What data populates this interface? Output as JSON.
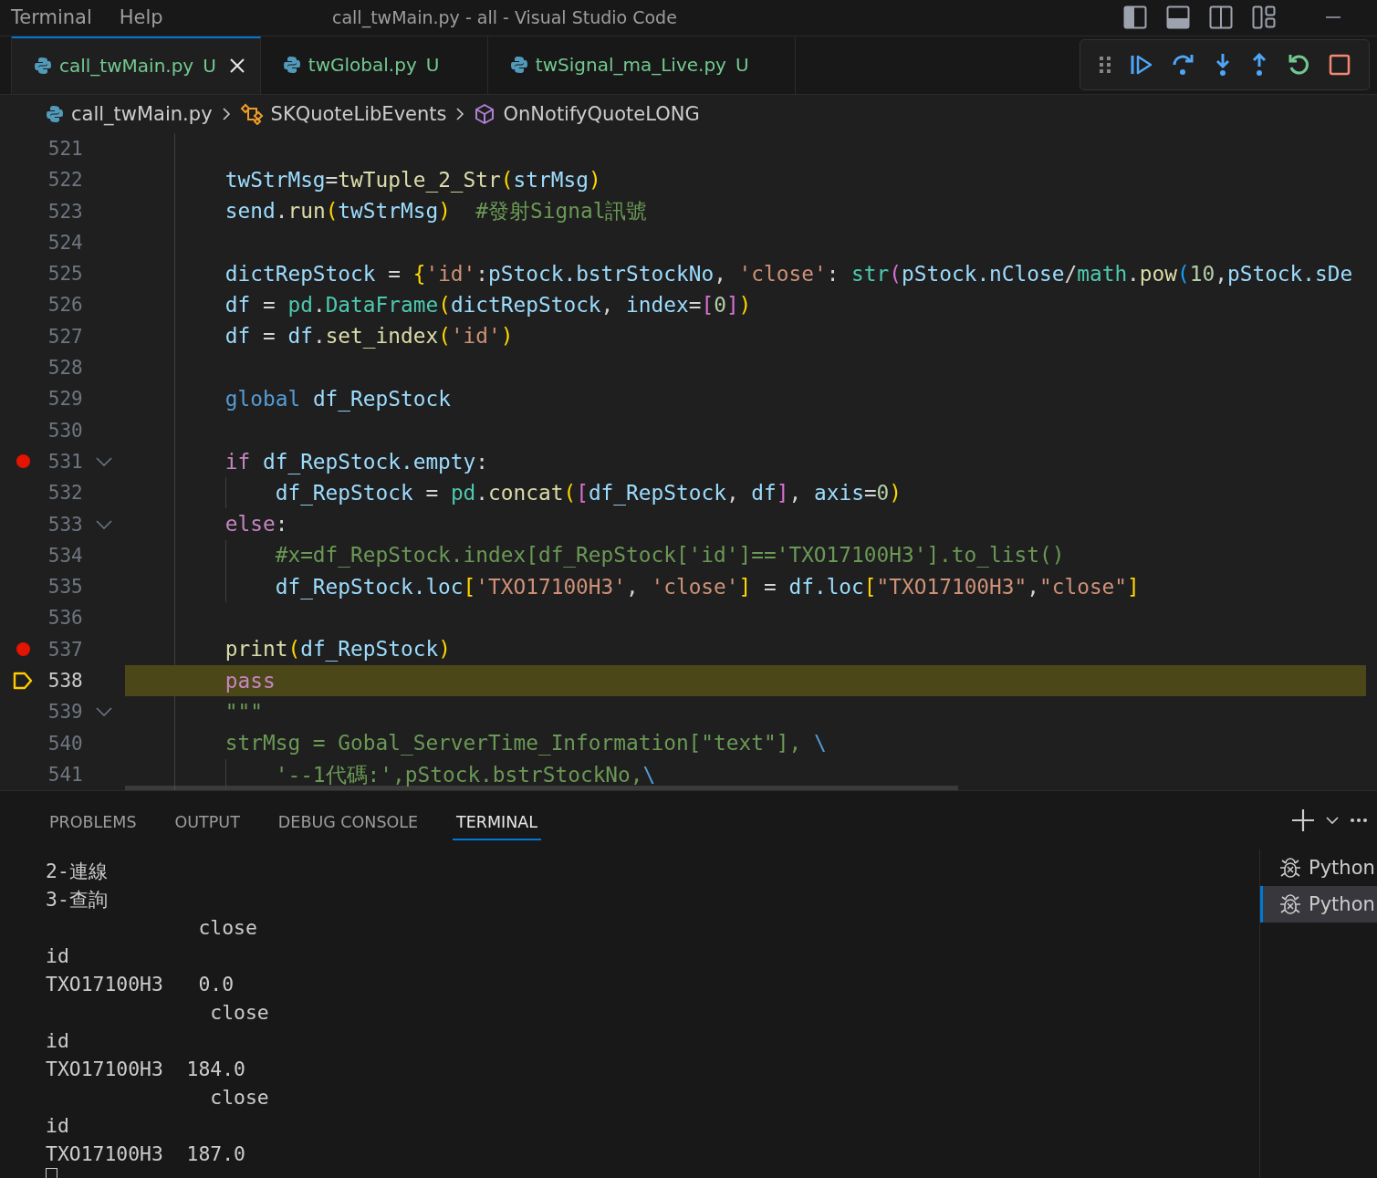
{
  "menu": [
    "Terminal",
    "Help"
  ],
  "window": {
    "title": "call_twMain.py - all - Visual Studio Code"
  },
  "tabs": [
    {
      "label": "call_twMain.py",
      "status": "U",
      "selected": true
    },
    {
      "label": "twGlobal.py",
      "status": "U",
      "selected": false
    },
    {
      "label": "twSignal_ma_Live.py",
      "status": "U",
      "selected": false
    }
  ],
  "breadcrumb": [
    {
      "label": "call_twMain.py",
      "kind": "file"
    },
    {
      "label": "SKQuoteLibEvents",
      "kind": "class"
    },
    {
      "label": "OnNotifyQuoteLONG",
      "kind": "method"
    }
  ],
  "editor": {
    "lines": [
      {
        "number": "521",
        "breakpoint": false,
        "fold": false,
        "current": false
      },
      {
        "number": "522",
        "breakpoint": false,
        "fold": false,
        "current": false,
        "tokens": [
          {
            "text": "        twStrMsg",
            "kind": "var"
          },
          {
            "text": "=",
            "kind": "plain"
          },
          {
            "text": "twTuple_2_Str",
            "kind": "func"
          },
          {
            "text": "(",
            "kind": "brace1"
          },
          {
            "text": "strMsg",
            "kind": "var"
          },
          {
            "text": ")",
            "kind": "brace1"
          }
        ]
      },
      {
        "number": "523",
        "breakpoint": false,
        "fold": false,
        "current": false,
        "tokens": [
          {
            "text": "        send",
            "kind": "var"
          },
          {
            "text": ".",
            "kind": "plain"
          },
          {
            "text": "run",
            "kind": "func"
          },
          {
            "text": "(",
            "kind": "brace1"
          },
          {
            "text": "twStrMsg",
            "kind": "var"
          },
          {
            "text": ")",
            "kind": "brace1"
          },
          {
            "text": "  #發射Signal訊號",
            "kind": "comment"
          }
        ]
      },
      {
        "number": "524",
        "breakpoint": false,
        "fold": false,
        "current": false
      },
      {
        "number": "525",
        "breakpoint": false,
        "fold": false,
        "current": false,
        "tokens": [
          {
            "text": "        dictRepStock",
            "kind": "var"
          },
          {
            "text": " = ",
            "kind": "plain"
          },
          {
            "text": "{",
            "kind": "brace1"
          },
          {
            "text": "'id'",
            "kind": "string"
          },
          {
            "text": ":",
            "kind": "plain"
          },
          {
            "text": "pStock.bstrStockNo",
            "kind": "var"
          },
          {
            "text": ", ",
            "kind": "plain"
          },
          {
            "text": "'close'",
            "kind": "string"
          },
          {
            "text": ": ",
            "kind": "plain"
          },
          {
            "text": "str",
            "kind": "type"
          },
          {
            "text": "(",
            "kind": "brace2"
          },
          {
            "text": "pStock.nClose",
            "kind": "var"
          },
          {
            "text": "/",
            "kind": "plain"
          },
          {
            "text": "math",
            "kind": "type"
          },
          {
            "text": ".",
            "kind": "plain"
          },
          {
            "text": "pow",
            "kind": "func"
          },
          {
            "text": "(",
            "kind": "brace3"
          },
          {
            "text": "10",
            "kind": "number"
          },
          {
            "text": ",",
            "kind": "plain"
          },
          {
            "text": "pStock.sDe",
            "kind": "var"
          }
        ]
      },
      {
        "number": "526",
        "breakpoint": false,
        "fold": false,
        "current": false,
        "tokens": [
          {
            "text": "        df",
            "kind": "var"
          },
          {
            "text": " = ",
            "kind": "plain"
          },
          {
            "text": "pd",
            "kind": "type"
          },
          {
            "text": ".",
            "kind": "plain"
          },
          {
            "text": "DataFrame",
            "kind": "type"
          },
          {
            "text": "(",
            "kind": "brace1"
          },
          {
            "text": "dictRepStock",
            "kind": "var"
          },
          {
            "text": ", ",
            "kind": "plain"
          },
          {
            "text": "index",
            "kind": "var"
          },
          {
            "text": "=",
            "kind": "plain"
          },
          {
            "text": "[",
            "kind": "brace2"
          },
          {
            "text": "0",
            "kind": "number"
          },
          {
            "text": "]",
            "kind": "brace2"
          },
          {
            "text": ")",
            "kind": "brace1"
          }
        ]
      },
      {
        "number": "527",
        "breakpoint": false,
        "fold": false,
        "current": false,
        "tokens": [
          {
            "text": "        df",
            "kind": "var"
          },
          {
            "text": " = ",
            "kind": "plain"
          },
          {
            "text": "df",
            "kind": "var"
          },
          {
            "text": ".",
            "kind": "plain"
          },
          {
            "text": "set_index",
            "kind": "func"
          },
          {
            "text": "(",
            "kind": "brace1"
          },
          {
            "text": "'id'",
            "kind": "string"
          },
          {
            "text": ")",
            "kind": "brace1"
          }
        ]
      },
      {
        "number": "528",
        "breakpoint": false,
        "fold": false,
        "current": false
      },
      {
        "number": "529",
        "breakpoint": false,
        "fold": false,
        "current": false,
        "tokens": [
          {
            "text": "        global",
            "kind": "keyword"
          },
          {
            "text": " df_RepStock",
            "kind": "var"
          }
        ]
      },
      {
        "number": "530",
        "breakpoint": false,
        "fold": false,
        "current": false
      },
      {
        "number": "531",
        "breakpoint": true,
        "fold": true,
        "current": false,
        "tokens": [
          {
            "text": "        if",
            "kind": "control"
          },
          {
            "text": " df_RepStock.empty",
            "kind": "var"
          },
          {
            "text": ":",
            "kind": "plain"
          }
        ]
      },
      {
        "number": "532",
        "breakpoint": false,
        "fold": false,
        "current": false,
        "tokens": [
          {
            "text": "            df_RepStock",
            "kind": "var"
          },
          {
            "text": " = ",
            "kind": "plain"
          },
          {
            "text": "pd",
            "kind": "type"
          },
          {
            "text": ".",
            "kind": "plain"
          },
          {
            "text": "concat",
            "kind": "func"
          },
          {
            "text": "(",
            "kind": "brace1"
          },
          {
            "text": "[",
            "kind": "brace2"
          },
          {
            "text": "df_RepStock",
            "kind": "var"
          },
          {
            "text": ", ",
            "kind": "plain"
          },
          {
            "text": "df",
            "kind": "var"
          },
          {
            "text": "]",
            "kind": "brace2"
          },
          {
            "text": ", ",
            "kind": "plain"
          },
          {
            "text": "axis",
            "kind": "var"
          },
          {
            "text": "=",
            "kind": "plain"
          },
          {
            "text": "0",
            "kind": "number"
          },
          {
            "text": ")",
            "kind": "brace1"
          }
        ]
      },
      {
        "number": "533",
        "breakpoint": false,
        "fold": true,
        "current": false,
        "tokens": [
          {
            "text": "        else",
            "kind": "control"
          },
          {
            "text": ":",
            "kind": "plain"
          }
        ]
      },
      {
        "number": "534",
        "breakpoint": false,
        "fold": false,
        "current": false,
        "tokens": [
          {
            "text": "            #x=df_RepStock.index[df_RepStock['id']=='TXO17100H3'].to_list()",
            "kind": "comment"
          }
        ]
      },
      {
        "number": "535",
        "breakpoint": false,
        "fold": false,
        "current": false,
        "tokens": [
          {
            "text": "            df_RepStock.loc",
            "kind": "var"
          },
          {
            "text": "[",
            "kind": "brace1"
          },
          {
            "text": "'TXO17100H3'",
            "kind": "string"
          },
          {
            "text": ", ",
            "kind": "plain"
          },
          {
            "text": "'close'",
            "kind": "string"
          },
          {
            "text": "]",
            "kind": "brace1"
          },
          {
            "text": " = ",
            "kind": "plain"
          },
          {
            "text": "df.loc",
            "kind": "var"
          },
          {
            "text": "[",
            "kind": "brace1"
          },
          {
            "text": "\"TXO17100H3\"",
            "kind": "string"
          },
          {
            "text": ",",
            "kind": "plain"
          },
          {
            "text": "\"close\"",
            "kind": "string"
          },
          {
            "text": "]",
            "kind": "brace1"
          }
        ]
      },
      {
        "number": "536",
        "breakpoint": false,
        "fold": false,
        "current": false
      },
      {
        "number": "537",
        "breakpoint": true,
        "fold": false,
        "current": false,
        "tokens": [
          {
            "text": "        print",
            "kind": "func"
          },
          {
            "text": "(",
            "kind": "brace1"
          },
          {
            "text": "df_RepStock",
            "kind": "var"
          },
          {
            "text": ")",
            "kind": "brace1"
          }
        ]
      },
      {
        "number": "538",
        "breakpoint": false,
        "fold": false,
        "current": true,
        "tokens": [
          {
            "text": "        pass",
            "kind": "control"
          }
        ]
      },
      {
        "number": "539",
        "breakpoint": false,
        "fold": true,
        "current": false,
        "tokens": [
          {
            "text": "        \"\"\"",
            "kind": "comment"
          }
        ]
      },
      {
        "number": "540",
        "breakpoint": false,
        "fold": false,
        "current": false,
        "tokens": [
          {
            "text": "        strMsg = Gobal_ServerTime_Information[\"text\"], ",
            "kind": "comment"
          },
          {
            "text": "\\",
            "kind": "escape"
          }
        ]
      },
      {
        "number": "541",
        "breakpoint": false,
        "fold": false,
        "current": false,
        "tokens": [
          {
            "text": "            '--1代碼:',pStock.bstrStockNo,",
            "kind": "comment"
          },
          {
            "text": "\\",
            "kind": "escape"
          }
        ]
      }
    ]
  },
  "panel": {
    "tabs": [
      {
        "label": "PROBLEMS",
        "selected": false
      },
      {
        "label": "OUTPUT",
        "selected": false
      },
      {
        "label": "DEBUG CONSOLE",
        "selected": false
      },
      {
        "label": "TERMINAL",
        "selected": true
      }
    ],
    "terminal_lines": [
      "2-連線",
      "3-查詢",
      "             close",
      "id",
      "TXO17100H3   0.0",
      "              close",
      "id",
      "TXO17100H3  184.0",
      "              close",
      "id",
      "TXO17100H3  187.0"
    ],
    "instances": [
      {
        "label": "Python",
        "selected": false
      },
      {
        "label": "Python",
        "selected": true
      }
    ]
  }
}
